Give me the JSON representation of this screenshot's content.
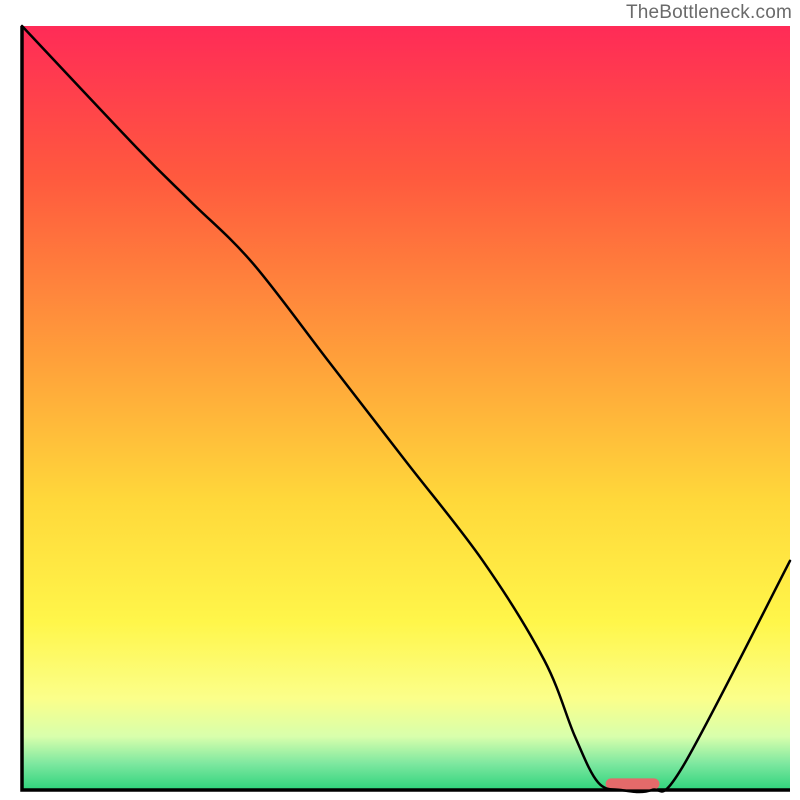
{
  "watermark": "TheBottleneck.com",
  "chart_data": {
    "type": "line",
    "title": "",
    "xlabel": "",
    "ylabel": "",
    "xlim": [
      0,
      100
    ],
    "ylim": [
      0,
      100
    ],
    "background_gradient": {
      "stops": [
        {
          "offset": 0.0,
          "color": "#ff2b57"
        },
        {
          "offset": 0.2,
          "color": "#ff5a3e"
        },
        {
          "offset": 0.45,
          "color": "#ffa43a"
        },
        {
          "offset": 0.62,
          "color": "#ffd83a"
        },
        {
          "offset": 0.78,
          "color": "#fff64a"
        },
        {
          "offset": 0.88,
          "color": "#fbff8a"
        },
        {
          "offset": 0.93,
          "color": "#d8ffac"
        },
        {
          "offset": 0.965,
          "color": "#7fe8a0"
        },
        {
          "offset": 1.0,
          "color": "#2ed37c"
        }
      ]
    },
    "series": [
      {
        "name": "bottleneck-curve",
        "x": [
          0,
          15,
          22,
          30,
          40,
          50,
          60,
          68,
          72,
          75,
          78,
          82,
          86,
          100
        ],
        "y": [
          100,
          84,
          77,
          69,
          56,
          43,
          30,
          17,
          7,
          1,
          0,
          0,
          3,
          30
        ]
      }
    ],
    "marker": {
      "name": "optimal-range",
      "x_start": 76,
      "x_end": 83,
      "y": 0.8,
      "color": "#e46a6a"
    },
    "axis_color": "#000000"
  }
}
